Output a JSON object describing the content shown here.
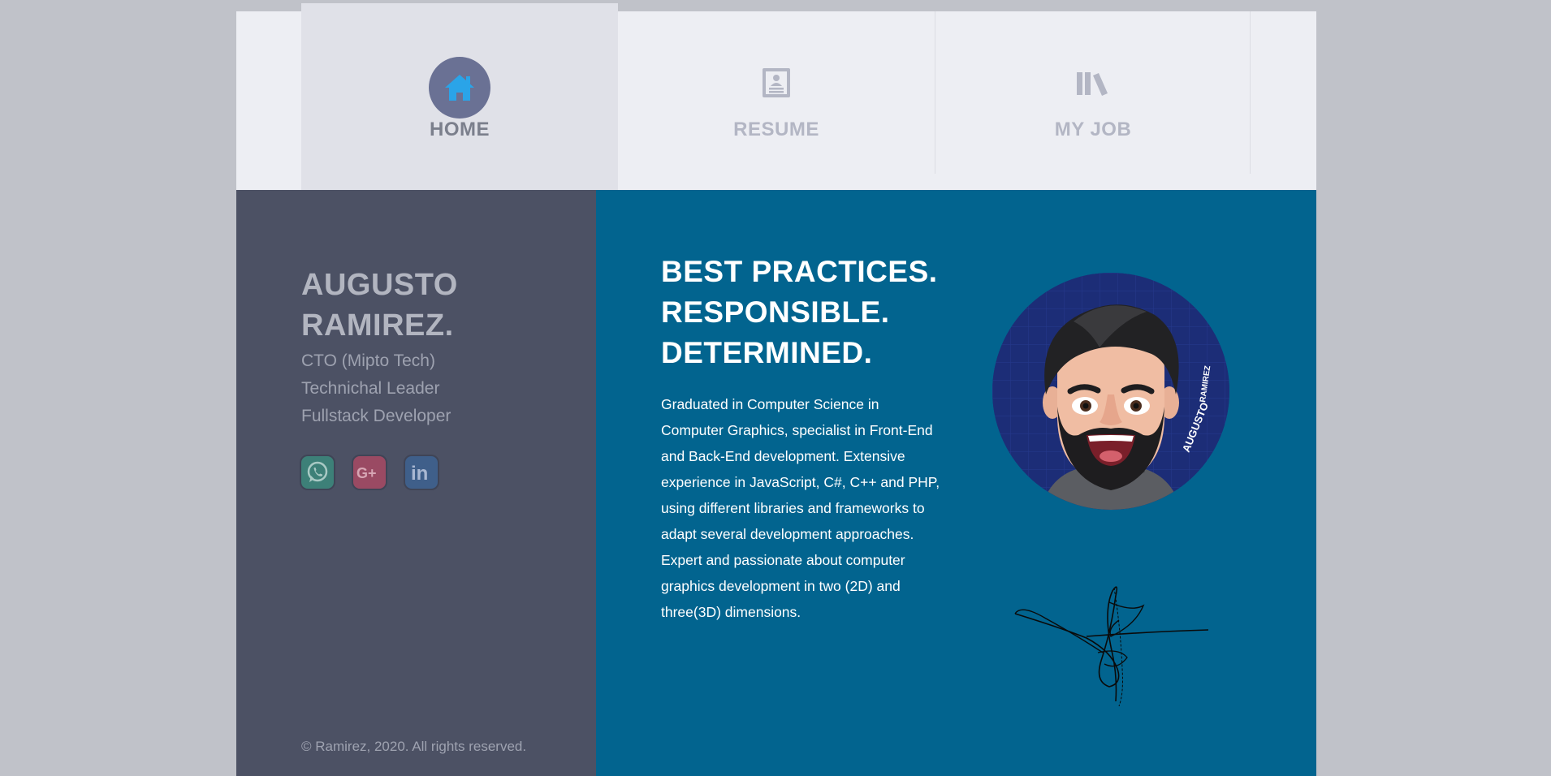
{
  "nav": {
    "tabs": [
      {
        "label": "HOME",
        "icon": "home-icon",
        "active": true
      },
      {
        "label": "RESUME",
        "icon": "resume-icon",
        "active": false
      },
      {
        "label": "MY JOB",
        "icon": "books-icon",
        "active": false
      }
    ]
  },
  "profile": {
    "name_line1": "AUGUSTO",
    "name_line2": "RAMIREZ.",
    "roles": [
      "CTO (Mipto Tech)",
      "Technichal Leader",
      "Fullstack Developer"
    ],
    "social": [
      {
        "name": "whatsapp-icon",
        "color": "#3d8078"
      },
      {
        "name": "google-plus-icon",
        "color": "#9a4a63"
      },
      {
        "name": "linkedin-icon",
        "color": "#3f5f8a"
      }
    ],
    "copyright": "© Ramirez, 2020. All rights reserved."
  },
  "main": {
    "headline": [
      "BEST PRACTICES.",
      "RESPONSIBLE.",
      "DETERMINED."
    ],
    "bio": "Graduated in Computer Science in Computer Graphics, specialist in Front-End and Back-End development. Extensive experience in JavaScript, C#, C++ and PHP, using different libraries and frameworks to adapt several development approaches. Expert and passionate about computer graphics development in two (2D) and three(3D) dimensions.",
    "avatar_text_1": "AUGUSTO",
    "avatar_text_2": "RAMIREZ"
  },
  "colors": {
    "page_bg": "#c0c2c9",
    "nav_bg": "#edeef3",
    "left_panel": "#4c5164",
    "right_panel": "#02648f",
    "accent": "#2aa4e8"
  }
}
